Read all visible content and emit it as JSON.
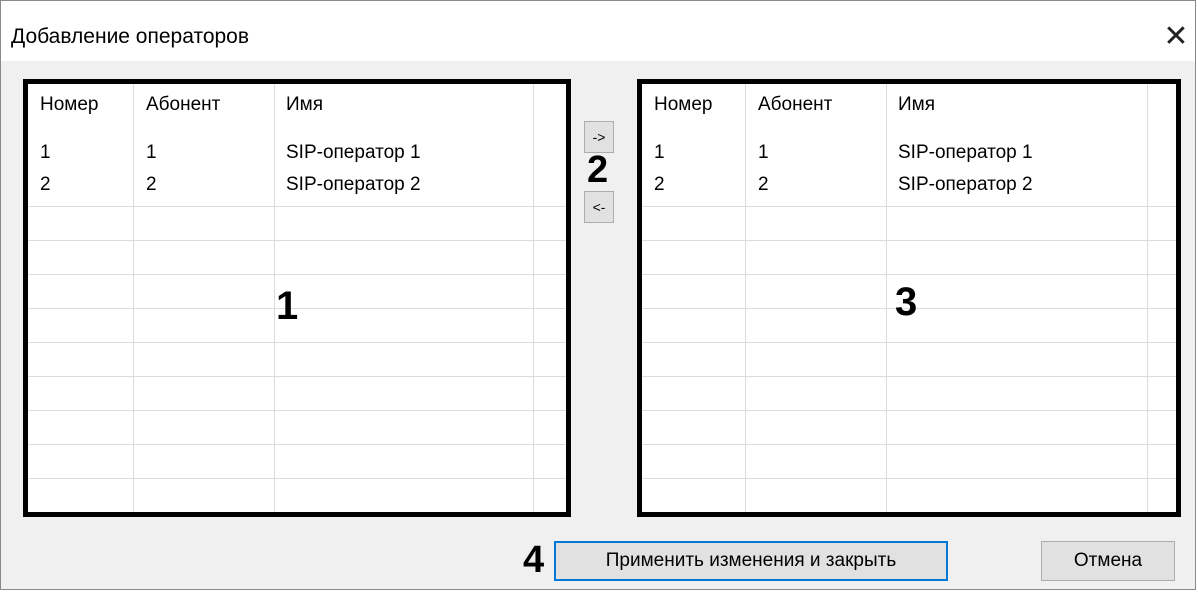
{
  "window": {
    "title": "Добавление операторов",
    "close_glyph": "✕"
  },
  "left_table": {
    "headers": [
      "Номер",
      "Абонент",
      "Имя"
    ],
    "rows": [
      [
        "1",
        "1",
        "SIP-оператор 1"
      ],
      [
        "2",
        "2",
        "SIP-оператор 2"
      ]
    ],
    "marker": "1"
  },
  "right_table": {
    "headers": [
      "Номер",
      "Абонент",
      "Имя"
    ],
    "rows": [
      [
        "1",
        "1",
        "SIP-оператор 1"
      ],
      [
        "2",
        "2",
        "SIP-оператор 2"
      ]
    ],
    "marker": "3"
  },
  "transfer": {
    "add_label": "->",
    "remove_label": "<-",
    "marker": "2"
  },
  "footer": {
    "marker": "4",
    "apply_label": "Применить изменения и закрыть",
    "cancel_label": "Отмена"
  },
  "colors": {
    "focus_border": "#0078d7",
    "button_bg": "#e1e1e1",
    "dialog_bg": "#f0f0f0"
  }
}
